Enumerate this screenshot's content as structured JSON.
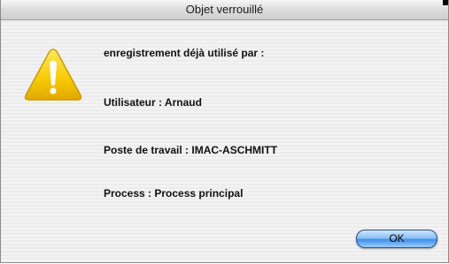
{
  "window": {
    "title": "Objet verrouillé"
  },
  "alert": {
    "icon": "warning-icon",
    "heading": "enregistrement déjà utilisé par :",
    "user_line": "Utilisateur : Arnaud",
    "workstation_line": "Poste de travail : IMAC-ASCHMITT",
    "process_line": "Process : Process principal"
  },
  "buttons": {
    "ok_label": "OK"
  },
  "colors": {
    "warning_fill": "#f7c900",
    "button_blue": "#3d8fe8"
  }
}
